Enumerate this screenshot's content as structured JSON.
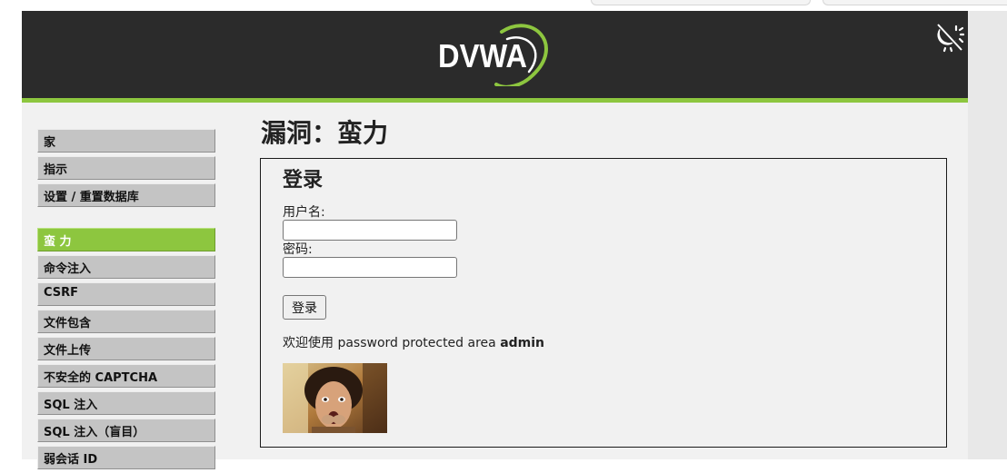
{
  "header": {
    "logo_text": "DVWA",
    "theme_icon": "theme-toggle-icon"
  },
  "sidebar": {
    "group1": [
      {
        "label": "家"
      },
      {
        "label": "指示"
      },
      {
        "label": "设置 / 重置数据库"
      }
    ],
    "group2": [
      {
        "label": "蛮 力",
        "active": true
      },
      {
        "label": "命令注入"
      },
      {
        "label": "CSRF"
      },
      {
        "label": "文件包含"
      },
      {
        "label": "文件上传"
      },
      {
        "label": "不安全的 CAPTCHA"
      },
      {
        "label": "SQL 注入"
      },
      {
        "label": "SQL 注入（盲目）"
      },
      {
        "label": "弱会话 ID"
      }
    ]
  },
  "main": {
    "page_title": "漏洞：蛮力",
    "form": {
      "title": "登录",
      "username_label": "用户名:",
      "username_value": "",
      "password_label": "密码:",
      "password_value": "",
      "submit_label": "登录"
    },
    "welcome": {
      "prefix": "欢迎使用 password protected area ",
      "user": "admin"
    },
    "image_alt": "user-avatar-photo"
  },
  "colors": {
    "header_bg": "#2b2b2b",
    "accent_green": "#8dc63f",
    "page_bg": "#f1f1f1",
    "menu_bg": "#c4c4c4"
  }
}
